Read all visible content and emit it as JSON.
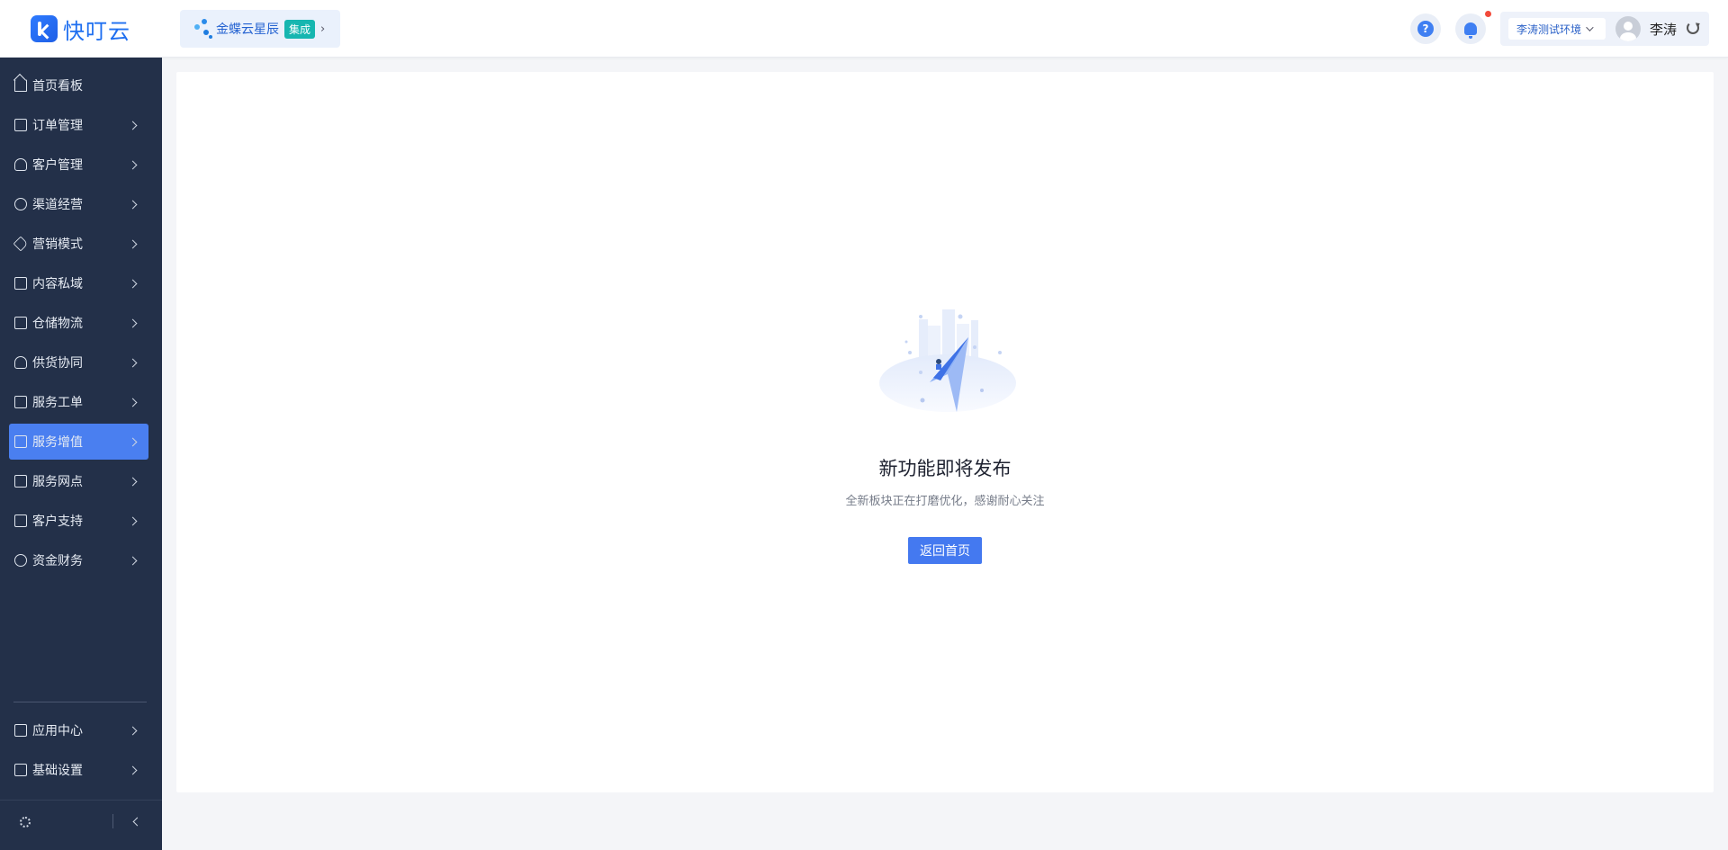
{
  "header": {
    "logo_text": "快叮云",
    "integration": {
      "name": "金蝶云星辰",
      "tag": "集成"
    },
    "environment": "李涛测试环境",
    "user_name": "李涛",
    "help_glyph": "?"
  },
  "sidebar": {
    "items": [
      {
        "label": "首页看板",
        "icon": "home-icon"
      },
      {
        "label": "订单管理",
        "icon": "order-icon"
      },
      {
        "label": "客户管理",
        "icon": "user-icon"
      },
      {
        "label": "渠道经营",
        "icon": "channel-icon"
      },
      {
        "label": "营销模式",
        "icon": "tag-icon"
      },
      {
        "label": "内容私域",
        "icon": "image-icon"
      },
      {
        "label": "仓储物流",
        "icon": "box-icon"
      },
      {
        "label": "供货协同",
        "icon": "supplier-icon"
      },
      {
        "label": "服务工单",
        "icon": "ticket-icon"
      },
      {
        "label": "服务增值",
        "icon": "bag-icon",
        "active": true
      },
      {
        "label": "服务网点",
        "icon": "store-icon"
      },
      {
        "label": "客户支持",
        "icon": "support-icon"
      },
      {
        "label": "资金财务",
        "icon": "yen-icon"
      }
    ],
    "bottom_items": [
      {
        "label": "应用中心",
        "icon": "cube-icon"
      },
      {
        "label": "基础设置",
        "icon": "settings-icon"
      }
    ]
  },
  "main": {
    "title": "新功能即将发布",
    "description": "全新板块正在打磨优化，感谢耐心关注",
    "back_button": "返回首页"
  },
  "colors": {
    "accent": "#4479f0",
    "sidebar_bg": "#233049",
    "integration_tag": "#16b6b0",
    "notification_dot": "#f24a3a"
  }
}
